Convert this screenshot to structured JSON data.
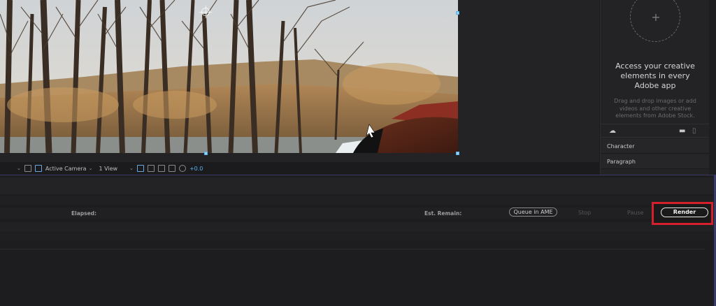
{
  "viewer": {
    "toolbar": {
      "camera_label": "Active Camera",
      "view_label": "1 View",
      "exposure_value": "+0.0"
    }
  },
  "cc_libraries": {
    "title_line1": "Access your creative",
    "title_line2": "elements in every",
    "title_line3": "Adobe app",
    "description_line1": "Drag and drop images or add",
    "description_line2": "videos and other creative",
    "description_line3": "elements from Adobe Stock.",
    "add_glyph": "+"
  },
  "panels": {
    "character_label": "Character",
    "paragraph_label": "Paragraph"
  },
  "render_queue": {
    "elapsed_label": "Elapsed:",
    "est_remain_label": "Est. Remain:",
    "queue_ame_label": "Queue in AME",
    "stop_label": "Stop",
    "pause_label": "Pause",
    "render_label": "Render",
    "highlight_color": "#d4202a"
  },
  "icons": [
    "resolution-dropdown-icon",
    "region-of-interest-icon",
    "transparency-grid-icon",
    "3d-view-icon",
    "fast-previews-icon",
    "flowchart-icon",
    "exposure-icon",
    "cloud-icon",
    "folder-icon",
    "trash-icon"
  ]
}
